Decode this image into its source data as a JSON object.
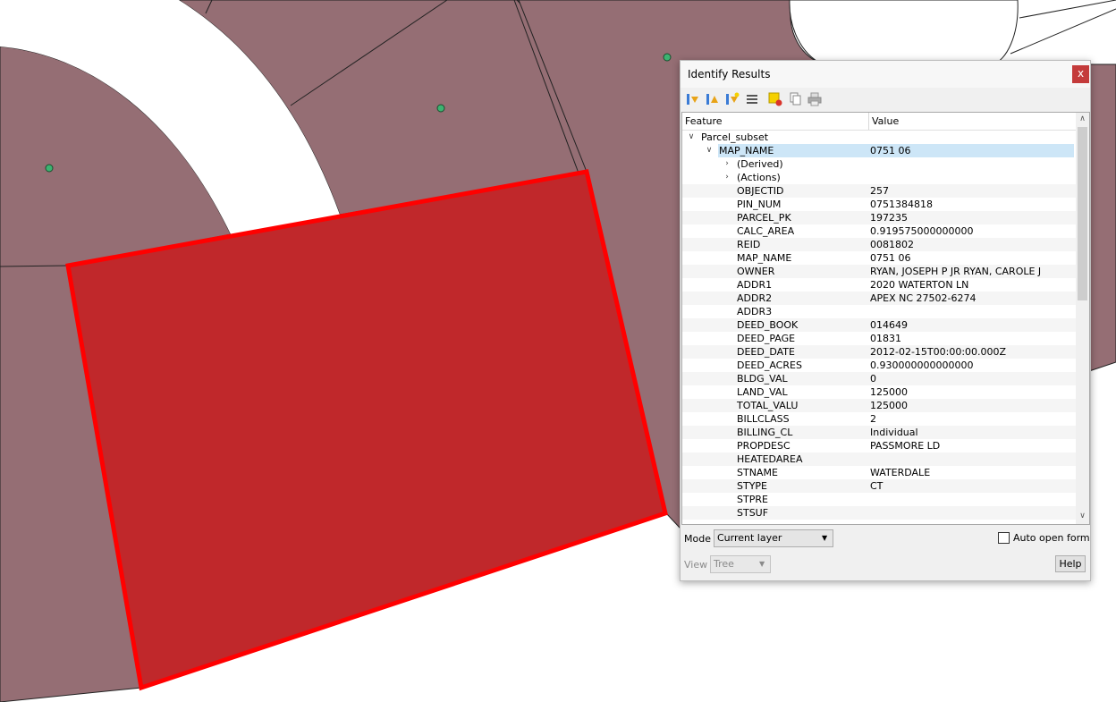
{
  "window": {
    "title": "Identify Results",
    "close_glyph": "x"
  },
  "toolbar": {
    "buttons": [
      "expand-tree-icon",
      "collapse-tree-icon",
      "expand-new-results-icon",
      "clear-results-icon",
      "deselect-features-icon",
      "copy-feature-icon",
      "print-icon"
    ]
  },
  "tree": {
    "headers": {
      "feature": "Feature",
      "value": "Value"
    },
    "layer": "Parcel_subset",
    "selected": {
      "field": "MAP_NAME",
      "value": "0751 06"
    },
    "groups": [
      "(Derived)",
      "(Actions)"
    ],
    "attributes": [
      {
        "field": "OBJECTID",
        "value": "257"
      },
      {
        "field": "PIN_NUM",
        "value": "0751384818"
      },
      {
        "field": "PARCEL_PK",
        "value": "197235"
      },
      {
        "field": "CALC_AREA",
        "value": "0.919575000000000"
      },
      {
        "field": "REID",
        "value": "0081802"
      },
      {
        "field": "MAP_NAME",
        "value": "0751 06"
      },
      {
        "field": "OWNER",
        "value": "RYAN, JOSEPH P JR RYAN, CAROLE J"
      },
      {
        "field": "ADDR1",
        "value": "2020 WATERTON LN"
      },
      {
        "field": "ADDR2",
        "value": "APEX NC 27502-6274"
      },
      {
        "field": "ADDR3",
        "value": ""
      },
      {
        "field": "DEED_BOOK",
        "value": "014649"
      },
      {
        "field": "DEED_PAGE",
        "value": "01831"
      },
      {
        "field": "DEED_DATE",
        "value": "2012-02-15T00:00:00.000Z"
      },
      {
        "field": "DEED_ACRES",
        "value": "0.930000000000000"
      },
      {
        "field": "BLDG_VAL",
        "value": "0"
      },
      {
        "field": "LAND_VAL",
        "value": "125000"
      },
      {
        "field": "TOTAL_VALU",
        "value": "125000"
      },
      {
        "field": "BILLCLASS",
        "value": "2"
      },
      {
        "field": "BILLING_CL",
        "value": "Individual"
      },
      {
        "field": "PROPDESC",
        "value": "PASSMORE LD"
      },
      {
        "field": "HEATEDAREA",
        "value": ""
      },
      {
        "field": "STNAME",
        "value": "WATERDALE"
      },
      {
        "field": "STYPE",
        "value": "CT"
      },
      {
        "field": "STPRE",
        "value": ""
      },
      {
        "field": "STSUF",
        "value": ""
      }
    ]
  },
  "footer": {
    "mode_label": "Mode",
    "mode_value": "Current layer",
    "auto_open_label": "Auto open form",
    "auto_open_checked": false,
    "view_label": "View",
    "view_value": "Tree",
    "help_label": "Help"
  },
  "colors": {
    "parcel_fill": "#956e74",
    "highlight_fill": "#c0282b",
    "highlight_stroke": "#ff0000",
    "point": "#3cb371",
    "selection": "#cde6f7",
    "close_button": "#c43b3b"
  }
}
